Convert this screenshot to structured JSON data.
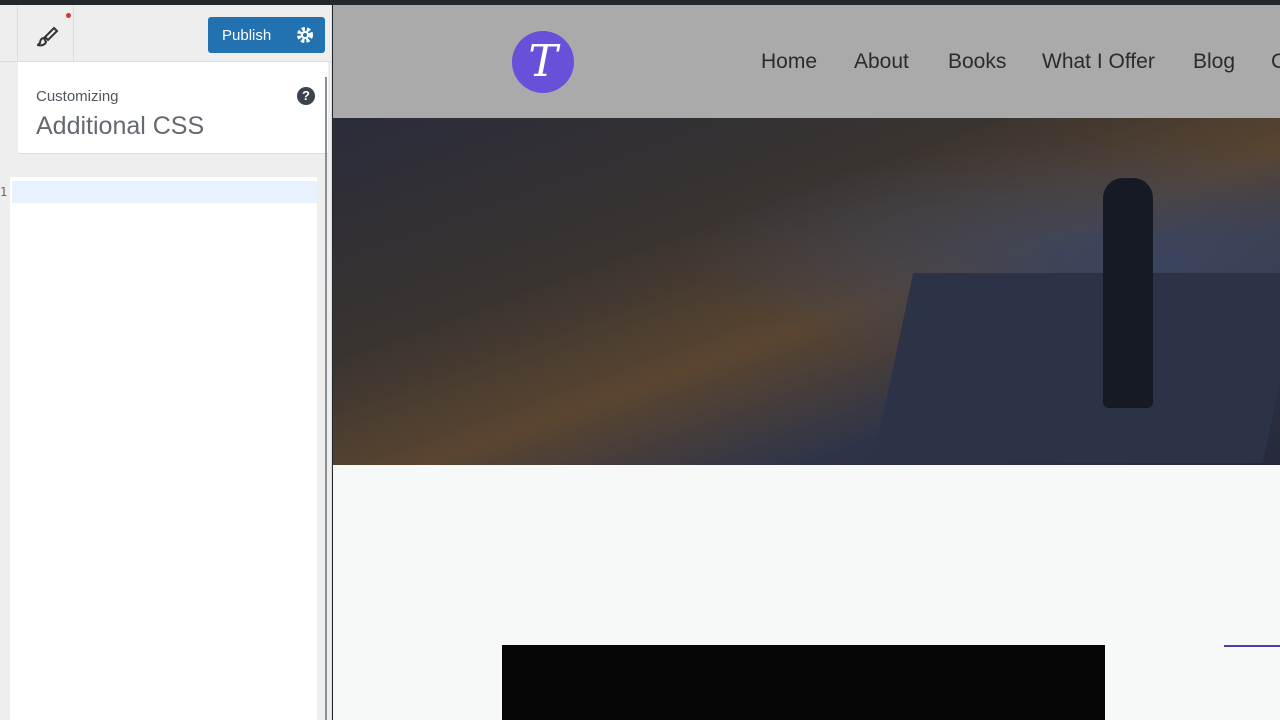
{
  "customizer": {
    "publish_label": "Publish",
    "customizing_label": "Customizing",
    "section_title": "Additional CSS",
    "help_icon": "?",
    "line_number": "1",
    "accent_color": "#2271b1"
  },
  "site": {
    "logo_letter": "T",
    "logo_color": "#6a4fd8",
    "nav": [
      "Home",
      "About",
      "Books",
      "What I Offer",
      "Blog",
      "Contact"
    ]
  }
}
